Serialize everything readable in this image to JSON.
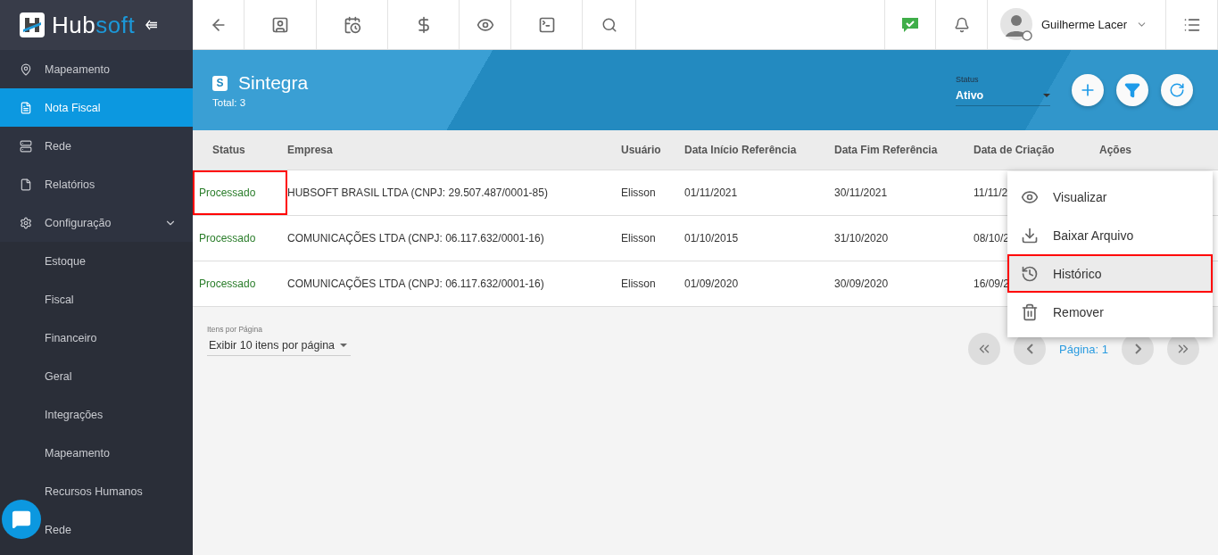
{
  "brand": {
    "name_dark": "Hub",
    "name_light": "soft"
  },
  "sidebar": {
    "items": [
      {
        "label": "Mapeamento",
        "selected": false
      },
      {
        "label": "Nota Fiscal",
        "selected": true
      },
      {
        "label": "Rede",
        "selected": false
      },
      {
        "label": "Relatórios",
        "selected": false
      },
      {
        "label": "Configuração",
        "selected": false,
        "expanded": true,
        "children": [
          {
            "label": "Estoque"
          },
          {
            "label": "Fiscal"
          },
          {
            "label": "Financeiro"
          },
          {
            "label": "Geral"
          },
          {
            "label": "Integrações"
          },
          {
            "label": "Mapeamento"
          },
          {
            "label": "Recursos Humanos"
          },
          {
            "label": "Rede"
          }
        ]
      }
    ]
  },
  "topbar": {
    "user": {
      "name": "Guilherme Lacer"
    }
  },
  "header": {
    "badge": "S",
    "title": "Sintegra",
    "total": "Total: 3",
    "status_filter": {
      "label": "Status",
      "value": "Ativo"
    }
  },
  "table": {
    "columns": [
      "Status",
      "Empresa",
      "Usuário",
      "Data Início Referência",
      "Data Fim Referência",
      "Data de Criação",
      "Ações"
    ],
    "rows": [
      {
        "highlighted": true,
        "cells": [
          "Processado",
          "HUBSOFT BRASIL LTDA (CNPJ: 29.507.487/0001-85)",
          "Elisson",
          "01/11/2021",
          "30/11/2021",
          "11/11/2"
        ]
      },
      {
        "highlighted": false,
        "cells": [
          "Processado",
          "COMUNICAÇÕES LTDA (CNPJ: 06.117.632/0001-16)",
          "Elisson",
          "01/10/2015",
          "31/10/2020",
          "08/10/2"
        ]
      },
      {
        "highlighted": false,
        "cells": [
          "Processado",
          "COMUNICAÇÕES LTDA (CNPJ: 06.117.632/0001-16)",
          "Elisson",
          "01/09/2020",
          "30/09/2020",
          "16/09/2"
        ]
      }
    ]
  },
  "page_size": {
    "label": "Itens por Página",
    "value": "Exibir 10 itens por página"
  },
  "pagination": {
    "page": "Página: 1"
  },
  "actions_menu": [
    {
      "label": "Visualizar",
      "kind": "view",
      "selected": false
    },
    {
      "label": "Baixar Arquivo",
      "kind": "download",
      "selected": false
    },
    {
      "label": "Histórico",
      "kind": "history",
      "selected": true
    },
    {
      "label": "Remover",
      "kind": "delete",
      "selected": false
    }
  ]
}
